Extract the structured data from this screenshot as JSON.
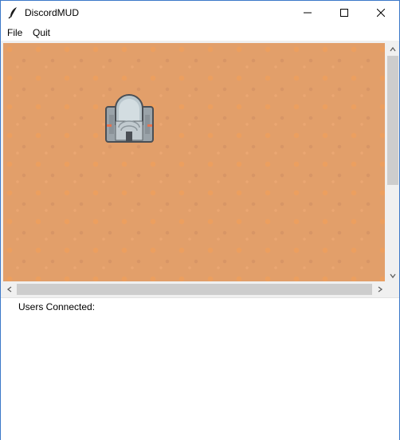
{
  "window": {
    "title": "DiscordMUD",
    "app_icon": "feather-icon",
    "controls": {
      "minimize_icon": "minimize-icon",
      "maximize_icon": "maximize-icon",
      "close_icon": "close-icon"
    }
  },
  "menu": {
    "items": [
      {
        "label": "File"
      },
      {
        "label": "Quit"
      }
    ]
  },
  "map": {
    "background_color": "#e29f6a",
    "sprite": "building-icon"
  },
  "scrollbars": {
    "vertical": {
      "up_icon": "chevron-up-icon",
      "down_icon": "chevron-down-icon"
    },
    "horizontal": {
      "left_icon": "chevron-left-icon",
      "right_icon": "chevron-right-icon"
    }
  },
  "users_panel": {
    "label": "Users Connected:"
  }
}
